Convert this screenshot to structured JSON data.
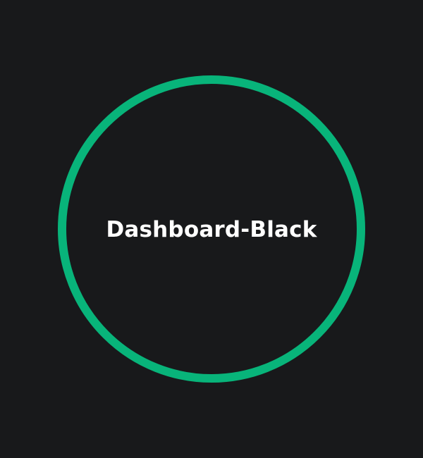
{
  "screen": {
    "title": "Dashboard-Black"
  },
  "colors": {
    "background": "#18191b",
    "ring": "#08b47a",
    "text": "#ffffff"
  }
}
